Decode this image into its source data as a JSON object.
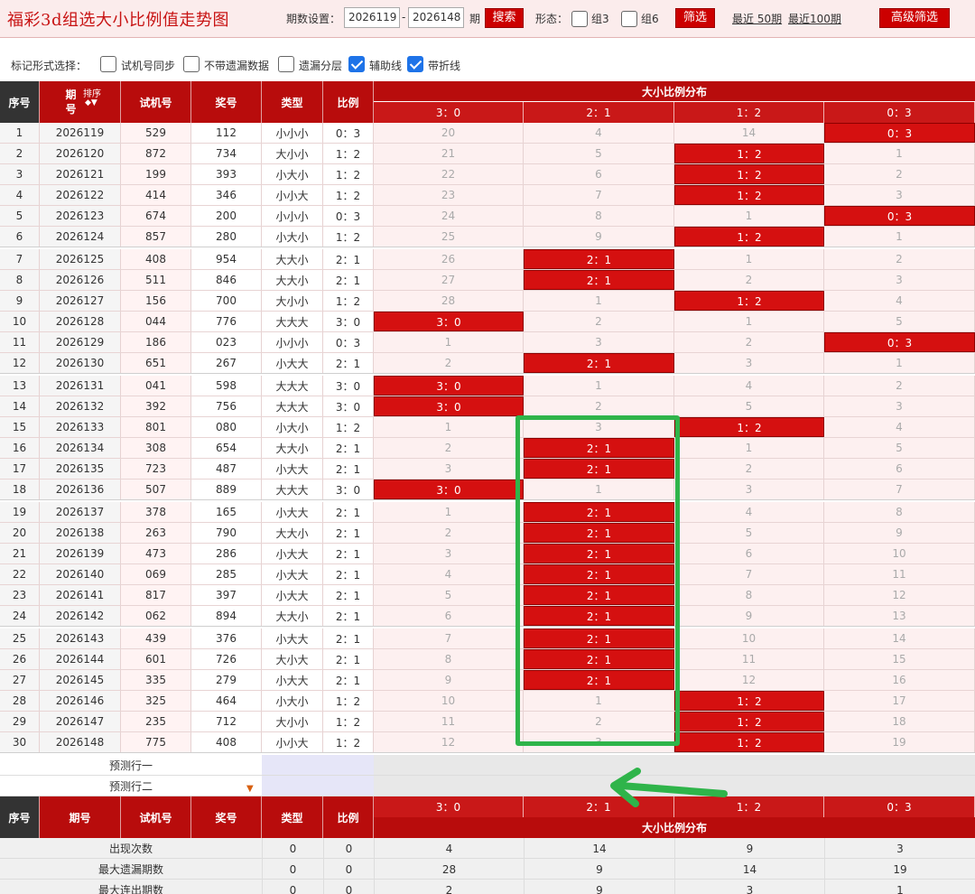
{
  "header": {
    "title": "福彩3d组选大小比例值走势图",
    "period_label": "期数设置：",
    "period_from": "2026119",
    "period_to": "2026148",
    "period_suffix": "期",
    "search_label": "搜索",
    "form_label": "形态：",
    "zu3_label": "组3",
    "zu6_label": "组6",
    "filter_label": "筛选",
    "recent50_label": "最近 50期",
    "recent100_label": "最近100期",
    "advanced_label": "高级筛选"
  },
  "options": {
    "label": "标记形式选择：",
    "items": [
      {
        "label": "试机号同步",
        "checked": false
      },
      {
        "label": "不带遗漏数据",
        "checked": false
      },
      {
        "label": "遗漏分层",
        "checked": false
      },
      {
        "label": "辅助线",
        "checked": true
      },
      {
        "label": "带折线",
        "checked": true
      }
    ]
  },
  "table": {
    "head": {
      "seq": "序号",
      "period": "期号",
      "sort": "排序",
      "trial": "试机号",
      "prize": "奖号",
      "type": "类型",
      "ratio": "比例",
      "dist": "大小比例分布",
      "cols": [
        "3：0",
        "2：1",
        "1：2",
        "0：3"
      ]
    },
    "rows": [
      {
        "seq": "1",
        "period": "2026119",
        "trial": "529",
        "prize": "112",
        "type": "小小小",
        "ratio": "0：3",
        "hit": 3,
        "cells": [
          "20",
          "4",
          "14",
          "0：3"
        ]
      },
      {
        "seq": "2",
        "period": "2026120",
        "trial": "872",
        "prize": "734",
        "type": "大小小",
        "ratio": "1：2",
        "hit": 2,
        "cells": [
          "21",
          "5",
          "1：2",
          "1"
        ]
      },
      {
        "seq": "3",
        "period": "2026121",
        "trial": "199",
        "prize": "393",
        "type": "小大小",
        "ratio": "1：2",
        "hit": 2,
        "cells": [
          "22",
          "6",
          "1：2",
          "2"
        ]
      },
      {
        "seq": "4",
        "period": "2026122",
        "trial": "414",
        "prize": "346",
        "type": "小小大",
        "ratio": "1：2",
        "hit": 2,
        "cells": [
          "23",
          "7",
          "1：2",
          "3"
        ]
      },
      {
        "seq": "5",
        "period": "2026123",
        "trial": "674",
        "prize": "200",
        "type": "小小小",
        "ratio": "0：3",
        "hit": 3,
        "cells": [
          "24",
          "8",
          "1",
          "0：3"
        ]
      },
      {
        "seq": "6",
        "period": "2026124",
        "trial": "857",
        "prize": "280",
        "type": "小大小",
        "ratio": "1：2",
        "hit": 2,
        "cells": [
          "25",
          "9",
          "1：2",
          "1"
        ]
      },
      {
        "seq": "7",
        "period": "2026125",
        "trial": "408",
        "prize": "954",
        "type": "大大小",
        "ratio": "2：1",
        "hit": 1,
        "cells": [
          "26",
          "2：1",
          "1",
          "2"
        ]
      },
      {
        "seq": "8",
        "period": "2026126",
        "trial": "511",
        "prize": "846",
        "type": "大大小",
        "ratio": "2：1",
        "hit": 1,
        "cells": [
          "27",
          "2：1",
          "2",
          "3"
        ]
      },
      {
        "seq": "9",
        "period": "2026127",
        "trial": "156",
        "prize": "700",
        "type": "大小小",
        "ratio": "1：2",
        "hit": 2,
        "cells": [
          "28",
          "1",
          "1：2",
          "4"
        ]
      },
      {
        "seq": "10",
        "period": "2026128",
        "trial": "044",
        "prize": "776",
        "type": "大大大",
        "ratio": "3：0",
        "hit": 0,
        "cells": [
          "3：0",
          "2",
          "1",
          "5"
        ]
      },
      {
        "seq": "11",
        "period": "2026129",
        "trial": "186",
        "prize": "023",
        "type": "小小小",
        "ratio": "0：3",
        "hit": 3,
        "cells": [
          "1",
          "3",
          "2",
          "0：3"
        ]
      },
      {
        "seq": "12",
        "period": "2026130",
        "trial": "651",
        "prize": "267",
        "type": "小大大",
        "ratio": "2：1",
        "hit": 1,
        "cells": [
          "2",
          "2：1",
          "3",
          "1"
        ]
      },
      {
        "seq": "13",
        "period": "2026131",
        "trial": "041",
        "prize": "598",
        "type": "大大大",
        "ratio": "3：0",
        "hit": 0,
        "cells": [
          "3：0",
          "1",
          "4",
          "2"
        ]
      },
      {
        "seq": "14",
        "period": "2026132",
        "trial": "392",
        "prize": "756",
        "type": "大大大",
        "ratio": "3：0",
        "hit": 0,
        "cells": [
          "3：0",
          "2",
          "5",
          "3"
        ]
      },
      {
        "seq": "15",
        "period": "2026133",
        "trial": "801",
        "prize": "080",
        "type": "小大小",
        "ratio": "1：2",
        "hit": 2,
        "cells": [
          "1",
          "3",
          "1：2",
          "4"
        ]
      },
      {
        "seq": "16",
        "period": "2026134",
        "trial": "308",
        "prize": "654",
        "type": "大大小",
        "ratio": "2：1",
        "hit": 1,
        "cells": [
          "2",
          "2：1",
          "1",
          "5"
        ]
      },
      {
        "seq": "17",
        "period": "2026135",
        "trial": "723",
        "prize": "487",
        "type": "小大大",
        "ratio": "2：1",
        "hit": 1,
        "cells": [
          "3",
          "2：1",
          "2",
          "6"
        ]
      },
      {
        "seq": "18",
        "period": "2026136",
        "trial": "507",
        "prize": "889",
        "type": "大大大",
        "ratio": "3：0",
        "hit": 0,
        "cells": [
          "3：0",
          "1",
          "3",
          "7"
        ]
      },
      {
        "seq": "19",
        "period": "2026137",
        "trial": "378",
        "prize": "165",
        "type": "小大大",
        "ratio": "2：1",
        "hit": 1,
        "cells": [
          "1",
          "2：1",
          "4",
          "8"
        ]
      },
      {
        "seq": "20",
        "period": "2026138",
        "trial": "263",
        "prize": "790",
        "type": "大大小",
        "ratio": "2：1",
        "hit": 1,
        "cells": [
          "2",
          "2：1",
          "5",
          "9"
        ]
      },
      {
        "seq": "21",
        "period": "2026139",
        "trial": "473",
        "prize": "286",
        "type": "小大大",
        "ratio": "2：1",
        "hit": 1,
        "cells": [
          "3",
          "2：1",
          "6",
          "10"
        ]
      },
      {
        "seq": "22",
        "period": "2026140",
        "trial": "069",
        "prize": "285",
        "type": "小大大",
        "ratio": "2：1",
        "hit": 1,
        "cells": [
          "4",
          "2：1",
          "7",
          "11"
        ]
      },
      {
        "seq": "23",
        "period": "2026141",
        "trial": "817",
        "prize": "397",
        "type": "小大大",
        "ratio": "2：1",
        "hit": 1,
        "cells": [
          "5",
          "2：1",
          "8",
          "12"
        ]
      },
      {
        "seq": "24",
        "period": "2026142",
        "trial": "062",
        "prize": "894",
        "type": "大大小",
        "ratio": "2：1",
        "hit": 1,
        "cells": [
          "6",
          "2：1",
          "9",
          "13"
        ]
      },
      {
        "seq": "25",
        "period": "2026143",
        "trial": "439",
        "prize": "376",
        "type": "小大大",
        "ratio": "2：1",
        "hit": 1,
        "cells": [
          "7",
          "2：1",
          "10",
          "14"
        ]
      },
      {
        "seq": "26",
        "period": "2026144",
        "trial": "601",
        "prize": "726",
        "type": "大小大",
        "ratio": "2：1",
        "hit": 1,
        "cells": [
          "8",
          "2：1",
          "11",
          "15"
        ]
      },
      {
        "seq": "27",
        "period": "2026145",
        "trial": "335",
        "prize": "279",
        "type": "小大大",
        "ratio": "2：1",
        "hit": 1,
        "cells": [
          "9",
          "2：1",
          "12",
          "16"
        ]
      },
      {
        "seq": "28",
        "period": "2026146",
        "trial": "325",
        "prize": "464",
        "type": "小大小",
        "ratio": "1：2",
        "hit": 2,
        "cells": [
          "10",
          "1",
          "1：2",
          "17"
        ]
      },
      {
        "seq": "29",
        "period": "2026147",
        "trial": "235",
        "prize": "712",
        "type": "大小小",
        "ratio": "1：2",
        "hit": 2,
        "cells": [
          "11",
          "2",
          "1：2",
          "18"
        ]
      },
      {
        "seq": "30",
        "period": "2026148",
        "trial": "775",
        "prize": "408",
        "type": "小小大",
        "ratio": "1：2",
        "hit": 2,
        "cells": [
          "12",
          "3",
          "1：2",
          "19"
        ]
      }
    ],
    "predict": [
      "预测行一",
      "预测行二"
    ],
    "stats": [
      {
        "label": "出现次数",
        "type": "0",
        "ratio": "0",
        "vals": [
          "4",
          "14",
          "9",
          "3"
        ]
      },
      {
        "label": "最大遗漏期数",
        "type": "0",
        "ratio": "0",
        "vals": [
          "28",
          "9",
          "14",
          "19"
        ]
      },
      {
        "label": "最大连出期数",
        "type": "0",
        "ratio": "0",
        "vals": [
          "2",
          "9",
          "3",
          "1"
        ]
      }
    ]
  },
  "colors": {
    "hit_red": "#d51010",
    "header_red": "#b80c0c",
    "annotation_green": "#2fb44a"
  }
}
